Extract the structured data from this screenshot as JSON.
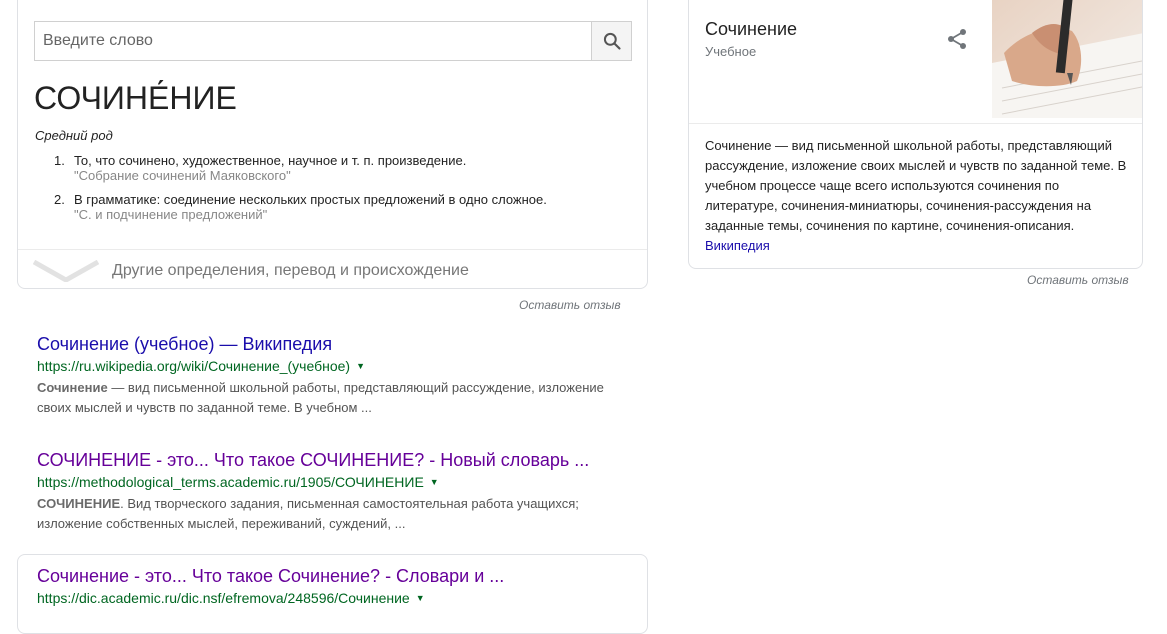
{
  "dictionary": {
    "search_placeholder": "Введите слово",
    "headword": "СОЧИНЕ́НИЕ",
    "part_of_speech": "Средний род",
    "definitions": [
      {
        "num": "1.",
        "text": "То, что сочинено, художественное, научное и т. п. произведение.",
        "example": "\"Собрание сочинений Маяковского\""
      },
      {
        "num": "2.",
        "text": "В грамматике: соединение нескольких простых предложений в одно сложное.",
        "example": "\"С. и подчинение предложений\""
      }
    ],
    "more_label": "Другие определения, перевод и происхождение",
    "feedback": "Оставить отзыв"
  },
  "results": [
    {
      "title": "Сочинение (учебное) — Википедия",
      "url": "https://ru.wikipedia.org/wiki/Сочинение_(учебное)",
      "snippet_bold": "Сочинение",
      "snippet_rest": " — вид письменной школьной работы, представляющий рассуждение, изложение своих мыслей и чувств по заданной теме. В учебном ..."
    },
    {
      "title": "СОЧИНЕНИЕ - это... Что такое СОЧИНЕНИЕ? - Новый словарь ...",
      "url": "https://methodological_terms.academic.ru/1905/СОЧИНЕНИЕ",
      "snippet_bold": "СОЧИНЕНИЕ",
      "snippet_rest": ". Вид творческого задания, письменная самостоятельная работа учащихся; изложение собственных мыслей, переживаний, суждений, ..."
    },
    {
      "title": "Сочинение - это... Что такое Сочинение? - Словари и ...",
      "url": "https://dic.academic.ru/dic.nsf/efremova/248596/Сочинение"
    }
  ],
  "knowledge_panel": {
    "title": "Сочинение",
    "subtitle": "Учебное",
    "description": "Сочинение — вид письменной школьной работы, представляющий рассуждение, изложение своих мыслей и чувств по заданной теме. В учебном процессе чаще всего используются сочинения по литературе, сочинения-миниатюры, сочинения-рассуждения на заданные темы, сочинения по картине, сочинения-описания.",
    "source_link": "Википедия",
    "feedback": "Оставить отзыв",
    "share_icon": "share-icon",
    "image_icon": "photo-hand-writing-with-pen"
  },
  "colors": {
    "link_blue": "#1a0dab",
    "link_visited": "#660099",
    "url_green": "#006621",
    "border": "#dfe1e5"
  }
}
